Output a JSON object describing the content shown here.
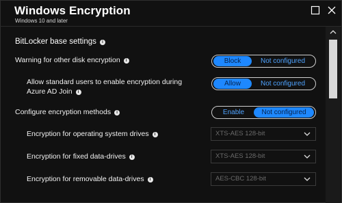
{
  "window": {
    "title": "Windows Encryption",
    "subtitle": "Windows 10 and later",
    "maximize_icon": "maximize-icon",
    "close_icon": "close-icon"
  },
  "section": {
    "title": "BitLocker base settings",
    "info_icon": "info-icon"
  },
  "settings": [
    {
      "label": "Warning for other disk encryption",
      "options": [
        "Block",
        "Not configured"
      ],
      "selected": "Block"
    },
    {
      "label": "Allow standard users to enable encryption during Azure AD Join",
      "options": [
        "Allow",
        "Not configured"
      ],
      "selected": "Allow"
    },
    {
      "label": "Configure encryption methods",
      "options": [
        "Enable",
        "Not configured"
      ],
      "selected": "Not configured"
    }
  ],
  "encryption_methods": [
    {
      "label": "Encryption for operating system drives",
      "value": "XTS-AES 128-bit"
    },
    {
      "label": "Encryption for fixed data-drives",
      "value": "XTS-AES 128-bit"
    },
    {
      "label": "Encryption for removable data-drives",
      "value": "AES-CBC 128-bit"
    }
  ],
  "colors": {
    "accent": "#1e88ff",
    "accent_text": "#4fa3ff",
    "background": "#111111",
    "disabled_text": "#6b6b6b"
  }
}
